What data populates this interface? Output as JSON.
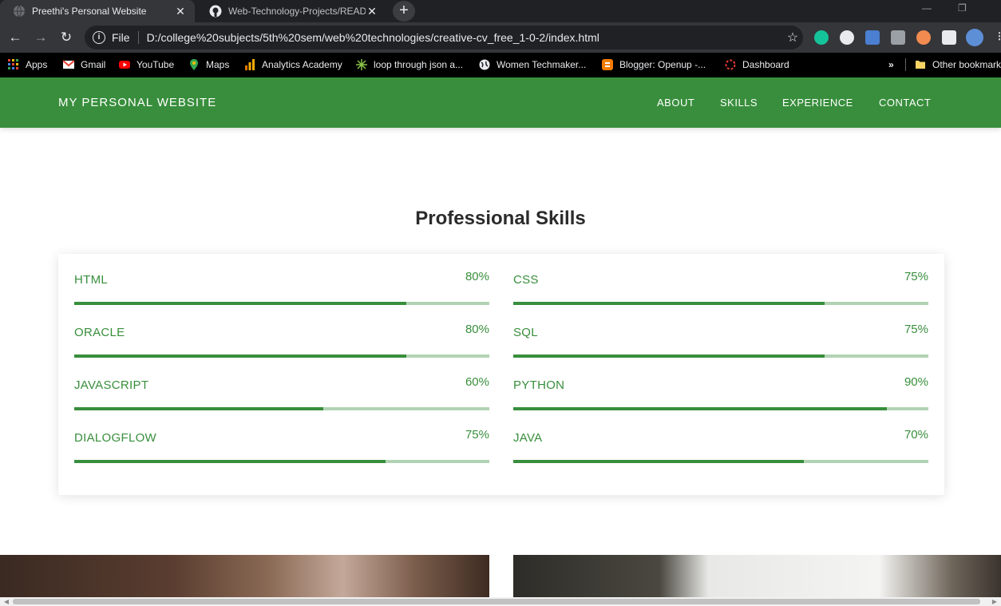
{
  "browser": {
    "tabs": [
      {
        "title": "Preethi's Personal Website",
        "active": true
      },
      {
        "title": "Web-Technology-Projects/README",
        "active": false
      }
    ],
    "omnibox": {
      "scheme": "File",
      "url": "D:/college%20subjects/5th%20sem/web%20technologies/creative-cv_free_1-0-2/index.html"
    },
    "bookmarks": [
      {
        "label": "Apps",
        "icon": "apps-grid-icon"
      },
      {
        "label": "Gmail",
        "icon": "gmail-icon"
      },
      {
        "label": "YouTube",
        "icon": "youtube-icon"
      },
      {
        "label": "Maps",
        "icon": "maps-pin-icon"
      },
      {
        "label": "Analytics Academy",
        "icon": "analytics-icon"
      },
      {
        "label": "loop through json a...",
        "icon": "sparkle-icon"
      },
      {
        "label": "Women Techmaker...",
        "icon": "globe-icon"
      },
      {
        "label": "Blogger: Openup -...",
        "icon": "blogger-icon"
      },
      {
        "label": "Dashboard",
        "icon": "dashboard-ring-icon"
      }
    ],
    "overflow_label": "»",
    "other_bookmarks": "Other bookmarks"
  },
  "site": {
    "brand": "MY PERSONAL WEBSITE",
    "nav": [
      "ABOUT",
      "SKILLS",
      "EXPERIENCE",
      "CONTACT"
    ],
    "colors": {
      "primary": "#388e3c",
      "track": "#b1d3b3"
    }
  },
  "skills_section": {
    "title": "Professional Skills",
    "left": [
      {
        "name": "HTML",
        "percent_label": "80%",
        "level": 80
      },
      {
        "name": "ORACLE",
        "percent_label": "80%",
        "level": 80
      },
      {
        "name": "JAVASCRIPT",
        "percent_label": "60%",
        "level": 60
      },
      {
        "name": "DIALOGFLOW",
        "percent_label": "75%",
        "level": 75
      }
    ],
    "right": [
      {
        "name": "CSS",
        "percent_label": "75%",
        "level": 75
      },
      {
        "name": "SQL",
        "percent_label": "75%",
        "level": 75
      },
      {
        "name": "PYTHON",
        "percent_label": "90%",
        "level": 90
      },
      {
        "name": "JAVA",
        "percent_label": "70%",
        "level": 70
      }
    ]
  }
}
